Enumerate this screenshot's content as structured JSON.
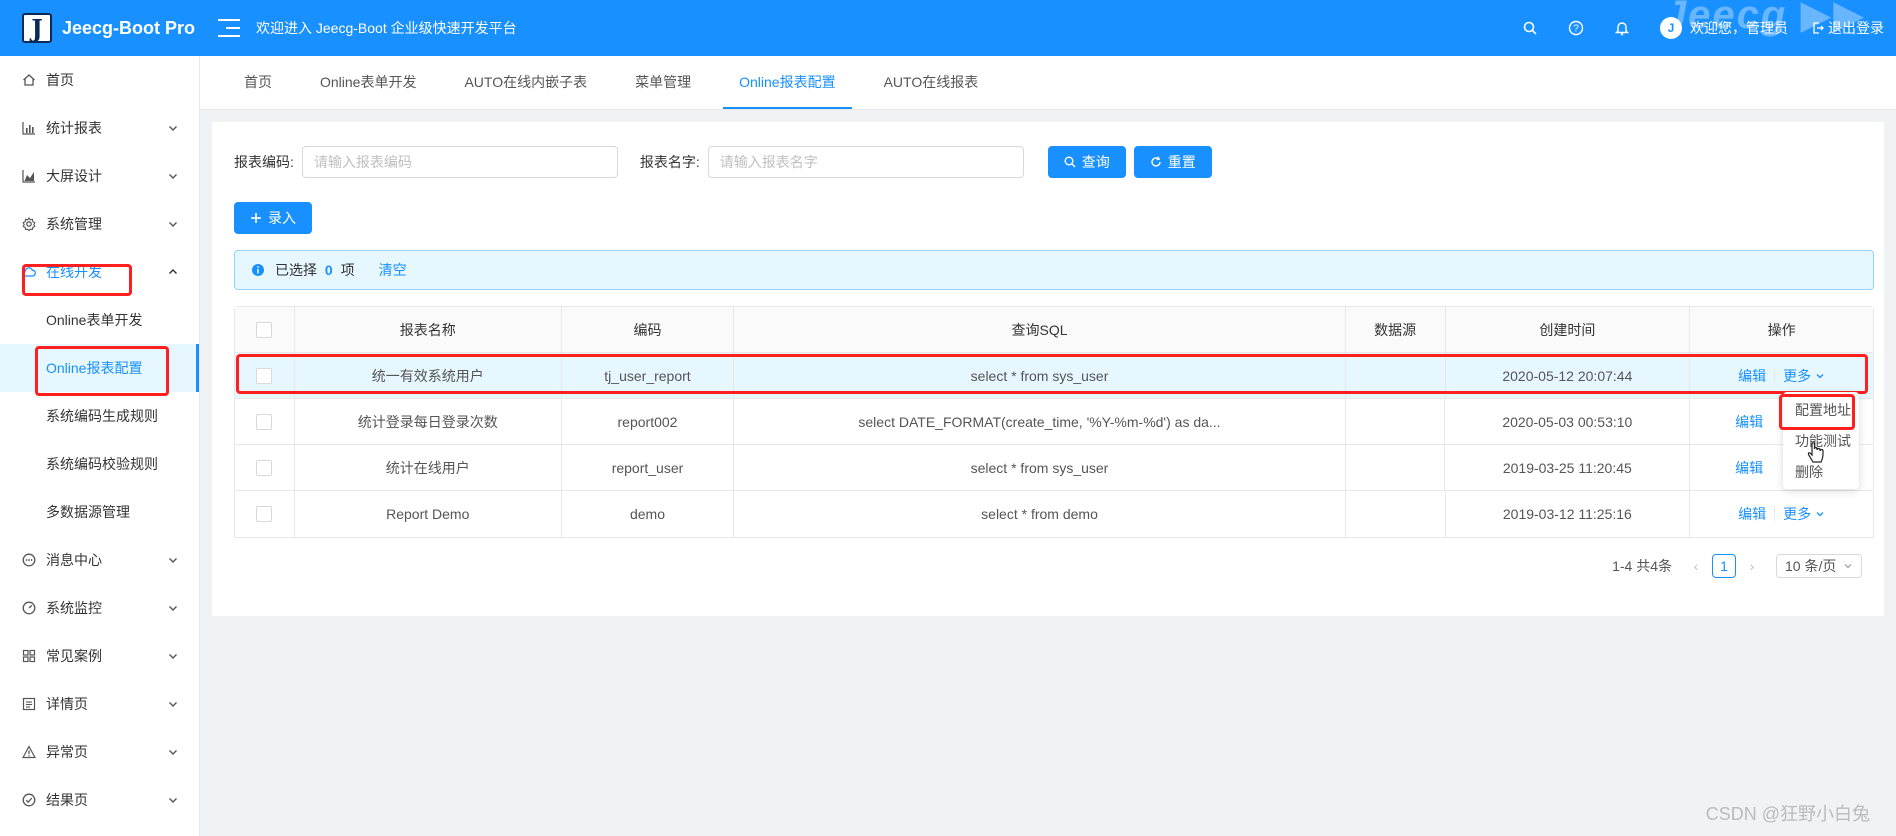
{
  "header": {
    "logo_letter": "J",
    "app_name": "Jeecg-Boot Pro",
    "welcome": "欢迎进入 Jeecg-Boot 企业级快速开发平台",
    "user_greeting": "欢迎您，管理员",
    "logout": "退出登录",
    "watermark": "Jeecg ▶▶"
  },
  "sidebar": {
    "items": [
      {
        "label": "首页",
        "icon": "home-icon"
      },
      {
        "label": "统计报表",
        "icon": "bar-chart-icon"
      },
      {
        "label": "大屏设计",
        "icon": "area-chart-icon"
      },
      {
        "label": "系统管理",
        "icon": "setting-icon"
      },
      {
        "label": "在线开发",
        "icon": "cloud-icon"
      },
      {
        "label": "消息中心",
        "icon": "message-icon"
      },
      {
        "label": "系统监控",
        "icon": "dashboard-icon"
      },
      {
        "label": "常见案例",
        "icon": "appstore-icon"
      },
      {
        "label": "详情页",
        "icon": "profile-icon"
      },
      {
        "label": "异常页",
        "icon": "warning-icon"
      },
      {
        "label": "结果页",
        "icon": "check-circle-icon"
      }
    ],
    "sub_items": [
      "Online表单开发",
      "Online报表配置",
      "系统编码生成规则",
      "系统编码校验规则",
      "多数据源管理"
    ]
  },
  "tabs": [
    "首页",
    "Online表单开发",
    "AUTO在线内嵌子表",
    "菜单管理",
    "Online报表配置",
    "AUTO在线报表"
  ],
  "search": {
    "code_label": "报表编码:",
    "code_placeholder": "请输入报表编码",
    "name_label": "报表名字:",
    "name_placeholder": "请输入报表名字",
    "query_button": "查询",
    "reset_button": "重置"
  },
  "add_button": "录入",
  "selection": {
    "prefix": "已选择",
    "count": "0",
    "suffix": "项",
    "clear": "清空"
  },
  "table": {
    "columns": [
      "报表名称",
      "编码",
      "查询SQL",
      "数据源",
      "创建时间",
      "操作"
    ],
    "rows": [
      {
        "name": "统一有效系统用户",
        "code": "tj_user_report",
        "sql": "select * from sys_user",
        "source": "",
        "created": "2020-05-12 20:07:44"
      },
      {
        "name": "统计登录每日登录次数",
        "code": "report002",
        "sql": "select DATE_FORMAT(create_time, '%Y-%m-%d') as da...",
        "source": "",
        "created": "2020-05-03 00:53:10"
      },
      {
        "name": "统计在线用户",
        "code": "report_user",
        "sql": "select * from sys_user",
        "source": "",
        "created": "2019-03-25 11:20:45"
      },
      {
        "name": "Report Demo",
        "code": "demo",
        "sql": "select * from demo",
        "source": "",
        "created": "2019-03-12 11:25:16"
      }
    ],
    "edit_label": "编辑",
    "more_label": "更多"
  },
  "dropdown": [
    "配置地址",
    "功能测试",
    "删除"
  ],
  "pagination": {
    "total": "1-4 共4条",
    "current_page": "1",
    "page_size": "10 条/页"
  },
  "csdn_watermark": "CSDN @狂野小白兔",
  "colors": {
    "primary": "#1890ff",
    "highlight_box": "#ff1f1f"
  }
}
